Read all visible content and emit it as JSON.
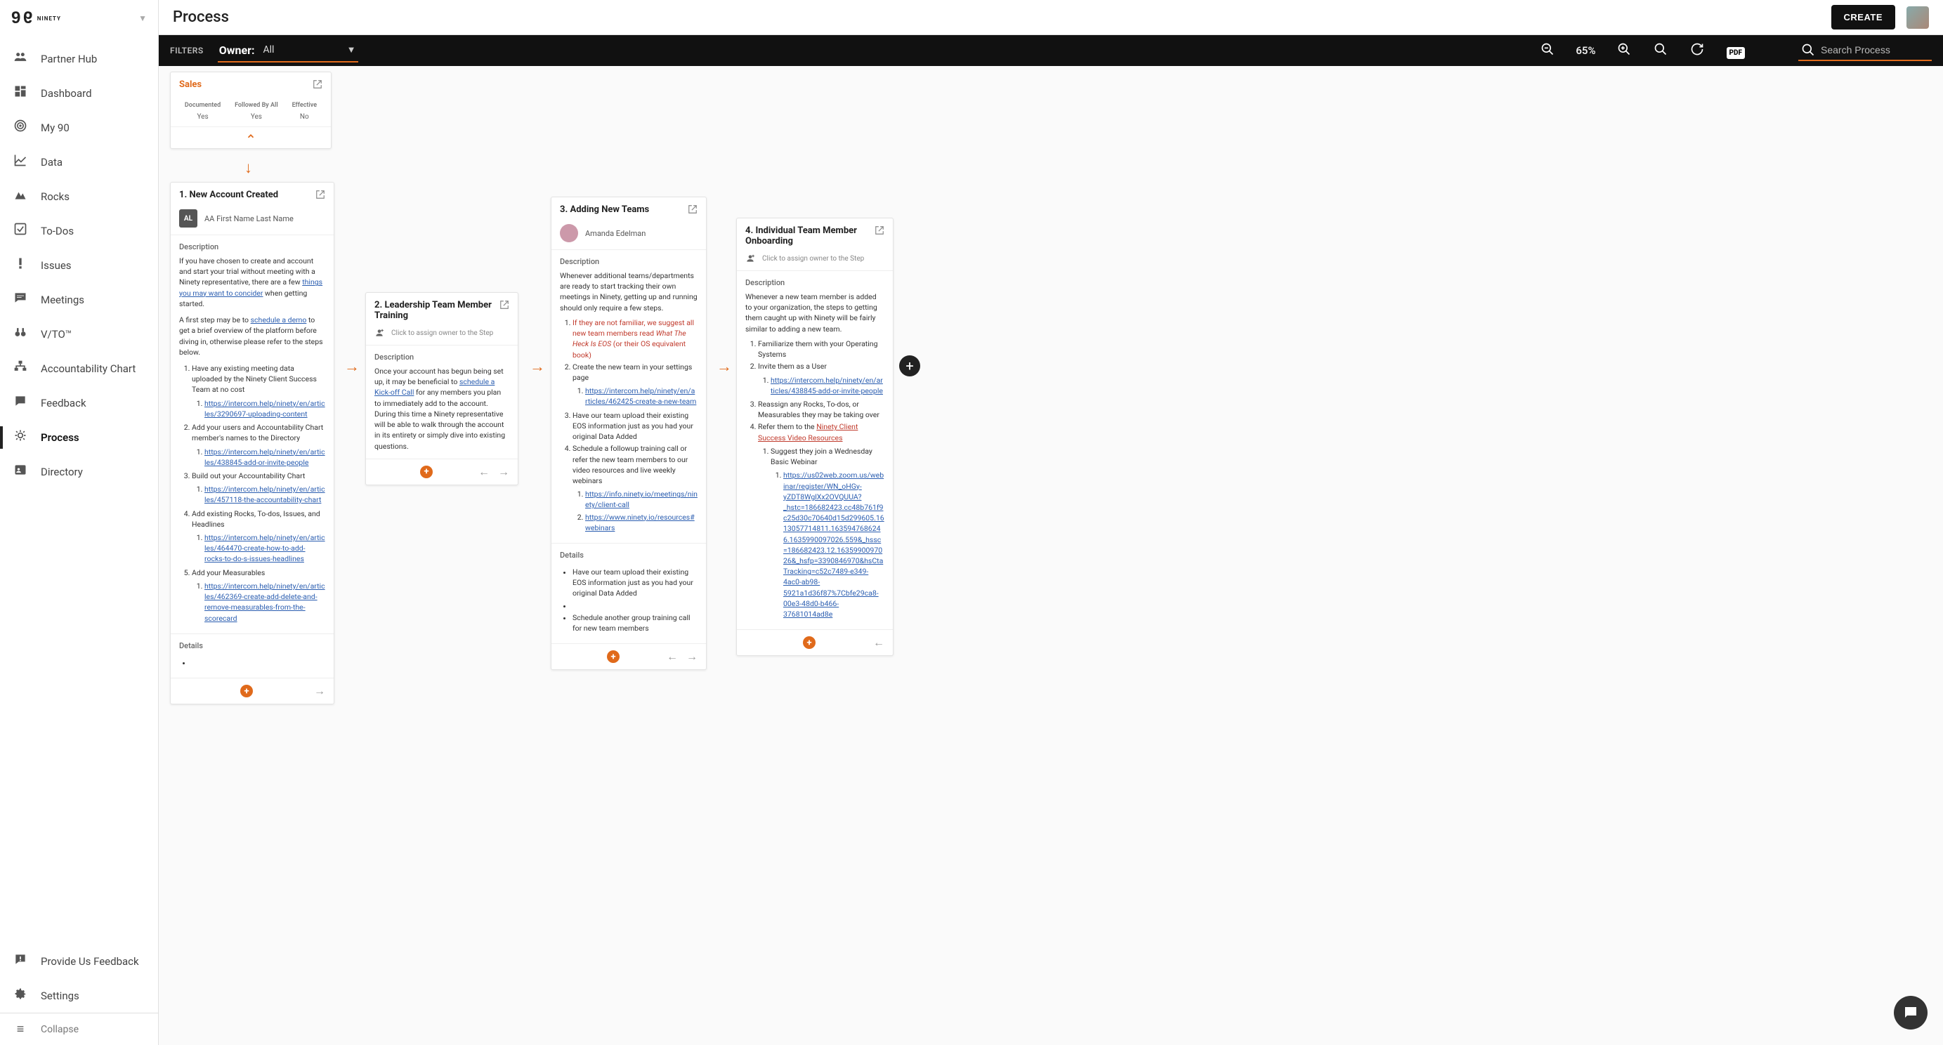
{
  "page": {
    "title": "Process",
    "create_btn": "CREATE"
  },
  "filterbar": {
    "filters_label": "FILTERS",
    "owner_label": "Owner:",
    "owner_value": "All",
    "zoom": "65%",
    "search_placeholder": "Search Process"
  },
  "sidebar": {
    "items": [
      {
        "icon": "people",
        "label": "Partner Hub"
      },
      {
        "icon": "dashboard",
        "label": "Dashboard"
      },
      {
        "icon": "target",
        "label": "My 90"
      },
      {
        "icon": "chart",
        "label": "Data"
      },
      {
        "icon": "mountain",
        "label": "Rocks"
      },
      {
        "icon": "check",
        "label": "To-Dos"
      },
      {
        "icon": "exclaim",
        "label": "Issues"
      },
      {
        "icon": "chat",
        "label": "Meetings"
      },
      {
        "icon": "binoc",
        "label": "V/TO™"
      },
      {
        "icon": "org",
        "label": "Accountability Chart"
      },
      {
        "icon": "bubble",
        "label": "Feedback"
      },
      {
        "icon": "process",
        "label": "Process",
        "active": true
      },
      {
        "icon": "directory",
        "label": "Directory"
      }
    ],
    "bottom": [
      {
        "icon": "feedback",
        "label": "Provide Us Feedback"
      },
      {
        "icon": "gear",
        "label": "Settings"
      }
    ],
    "collapse": "Collapse"
  },
  "process_root": {
    "title": "Sales",
    "cols": [
      {
        "h": "Documented",
        "v": "Yes"
      },
      {
        "h": "Followed By All",
        "v": "Yes"
      },
      {
        "h": "Effective",
        "v": "No"
      }
    ]
  },
  "steps": {
    "s1": {
      "title": "1. New Account Created",
      "owner_initials": "AL",
      "owner_name": "AA First Name Last Name",
      "desc_label": "Description",
      "p1a": "If you have chosen to create and account and start your trial without meeting with a Ninety representative, there are a few ",
      "p1_link": "things you may want to concider",
      "p1b": " when getting started.",
      "p2a": "A first step may be to ",
      "p2_link": "schedule a demo",
      "p2b": " to get a brief overview of the platform before diving in, otherwise please refer to the steps below.",
      "li1": "Have any existing meeting data uploaded by the Ninety Client Success Team at no cost",
      "li1a": "https://intercom.help/ninety/en/articles/3290697-uploading-content",
      "li2": "Add your users and Accountability Chart member's names to the Directory",
      "li2a": "https://intercom.help/ninety/en/articles/438845-add-or-invite-people",
      "li3": "Build out your Accountability Chart",
      "li3a": "https://intercom.help/ninety/en/articles/457118-the-accountability-chart",
      "li4": "Add existing Rocks, To-dos, Issues, and Headlines",
      "li4a": "https://intercom.help/ninety/en/articles/464470-create-how-to-add-rocks-to-do-s-issues-headlines",
      "li5": "Add your Measurables",
      "li5a": "https://intercom.help/ninety/en/articles/462369-create-add-delete-and-remove-measurables-from-the-scorecard",
      "details_label": "Details"
    },
    "s2": {
      "title": "2. Leadership Team Member Training",
      "assign": "Click to assign owner to the Step",
      "desc_label": "Description",
      "p1a": "Once your account has begun being set up, it may be beneficial to ",
      "p1_link": "schedule a Kick-off Call",
      "p1b": " for any members you plan to immediately add to the account. During this time a Ninety representative will be able to walk through the account in its entirety or simply dive into existing questions."
    },
    "s3": {
      "title": "3. Adding New Teams",
      "owner_name": "Amanda Edelman",
      "desc_label": "Description",
      "p1": "Whenever additional teams/departments are ready to start tracking their own meetings in Ninety, getting up and running should only require a few steps.",
      "li1a": "If they are not familiar, we suggest all new team members read ",
      "li1b": "What The Heck Is EOS",
      "li1c": " (or their OS equivalent book)",
      "li2": "Create the new team in your settings page",
      "li2a": "https://intercom.help/ninety/en/articles/462425-create-a-new-team",
      "li3": "Have our team upload their existing EOS information just as you had your original Data Added",
      "li4": "Schedule a followup training call or refer the new team members to our video resources and live weekly webinars",
      "li4a": "https://info.ninety.io/meetings/ninety/client-call",
      "li4b": "https://www.ninety.io/resources#webinars",
      "details_label": "Details",
      "d1": "Have our team upload their existing EOS information just as you had your original Data Added",
      "d2": "Schedule another group training call for new team members"
    },
    "s4": {
      "title": "4. Individual Team Member Onboarding",
      "assign": "Click to assign owner to the Step",
      "desc_label": "Description",
      "p1": "Whenever a new team member is added to your organization, the steps to getting them caught up with Ninety will be fairly similar to adding a new team.",
      "li1": "Familiarize them with your Operating Systems",
      "li2": "Invite them as a User",
      "li2a": "https://intercom.help/ninety/en/articles/438845-add-or-invite-people",
      "li3": "Reassign any Rocks, To-dos, or Measurables they may be taking over",
      "li4a": "Refer them to the ",
      "li4link": "Ninety Client Success Video Resources",
      "li4_1": "Suggest they join a Wednesday Basic Webinar",
      "li4_1a": "https://us02web.zoom.us/webinar/register/WN_oHGy-yZDT8WglXx2OVQUUA?_hstc=186682423.cc48b761f9c25d30c70640d15d299605.1613057714811.1635947686246.1635990097026.559&_hssc=186682423.12.1635990097026&_hsfp=3390846970&hsCtaTracking=c52c7489-e349-4ac0-ab98-5921a1d36f87%7Cbfe29ca8-00e3-48d0-b466-37681014ad8e"
    }
  }
}
